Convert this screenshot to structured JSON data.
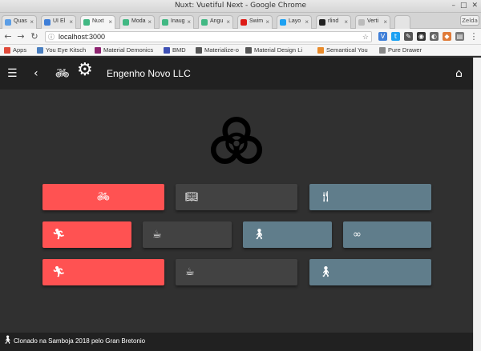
{
  "window": {
    "title": "Nuxt: Vuetiful Next - Google Chrome",
    "user": "Zelda"
  },
  "tabs": [
    {
      "label": "Quas",
      "color": "#5c9ee6"
    },
    {
      "label": "UI El",
      "color": "#3f7fd8"
    },
    {
      "label": "Nuxt",
      "color": "#41b883"
    },
    {
      "label": "Moda",
      "color": "#41b883"
    },
    {
      "label": "Inaug",
      "color": "#41b883"
    },
    {
      "label": "Angu",
      "color": "#41b883"
    },
    {
      "label": "Swim",
      "color": "#dd1b16"
    },
    {
      "label": "Layo",
      "color": "#1da1f2"
    },
    {
      "label": "rlind",
      "color": "#222222"
    },
    {
      "label": "Verti",
      "color": "#bbbbbb"
    }
  ],
  "toolbar": {
    "url": "localhost:3000"
  },
  "bookmarks": [
    {
      "label": "Apps",
      "color": "#e04a3a"
    },
    {
      "label": "You Eye Kitsch",
      "color": "#4a7fc0"
    },
    {
      "label": "Material Demonics",
      "color": "#8e2470"
    },
    {
      "label": "BMD",
      "color": "#3f51b5"
    },
    {
      "label": "Materialize-o",
      "color": "#555555"
    },
    {
      "label": "Material Design Li",
      "color": "#555555"
    },
    {
      "label": "Semantical You",
      "color": "#e98b2b"
    },
    {
      "label": "Pure Drawer",
      "color": "#888888"
    }
  ],
  "appbar": {
    "title": "Engenho Novo LLC"
  },
  "buttons": [
    {
      "color": "red",
      "icon": "bike-icon",
      "glyph": "🚲︎"
    },
    {
      "color": "dark",
      "icon": "book-icon",
      "glyph": "📖︎"
    },
    {
      "color": "blue",
      "icon": "restaurant-icon",
      "glyph": "🍴︎"
    },
    {
      "color": "red",
      "icon": "run-icon",
      "glyph": "🏃︎"
    },
    {
      "color": "dark",
      "icon": "coffee-icon",
      "glyph": "☕︎"
    },
    {
      "color": "blue",
      "icon": "walk-icon",
      "glyph": "🚶︎"
    },
    {
      "color": "blue",
      "icon": "infinity-icon",
      "glyph": "∞"
    },
    {
      "color": "red",
      "icon": "run-icon",
      "glyph": "🏃︎"
    },
    {
      "color": "dark",
      "icon": "coffee-icon",
      "glyph": "☕︎"
    },
    {
      "color": "blue",
      "icon": "walk-icon",
      "glyph": "🚶︎"
    }
  ],
  "footer": {
    "text": "Clonado na Samboja 2018 pelo Gran Bretonio"
  },
  "colors": {
    "red": "#ff5252",
    "dark": "#424242",
    "blue": "#607d8b",
    "appbar": "#212121",
    "background": "#303030"
  }
}
